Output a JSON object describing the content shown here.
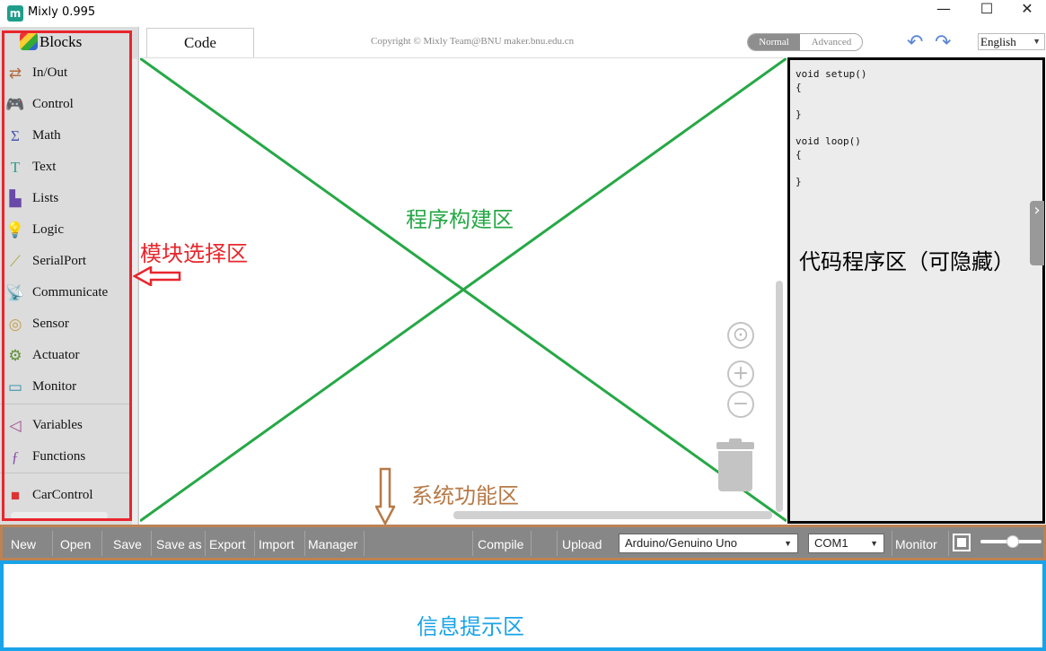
{
  "app": {
    "logo_text": "m",
    "title": "Mixly 0.995"
  },
  "window": {
    "minimize": "—",
    "maximize": "☐",
    "close": "✕"
  },
  "toolbox": {
    "header": "Blocks",
    "categories": [
      {
        "label": "In/Out",
        "icon": "in-out-icon",
        "glyph": "⇄",
        "color": "#b46a3c"
      },
      {
        "label": "Control",
        "icon": "gamepad-icon",
        "glyph": "🎮",
        "color": "#3d8a3d"
      },
      {
        "label": "Math",
        "icon": "math-icon",
        "glyph": "Σ",
        "color": "#4a55b0"
      },
      {
        "label": "Text",
        "icon": "text-icon",
        "glyph": "T",
        "color": "#2c9b8a"
      },
      {
        "label": "Lists",
        "icon": "lists-icon",
        "glyph": "▙",
        "color": "#6a4aa8"
      },
      {
        "label": "Logic",
        "icon": "lightbulb-icon",
        "glyph": "💡",
        "color": "#4479b8"
      },
      {
        "label": "SerialPort",
        "icon": "serial-port-icon",
        "glyph": "⟋",
        "color": "#a4a83a"
      },
      {
        "label": "Communicate",
        "icon": "satellite-icon",
        "glyph": "📡",
        "color": "#6b8f3b"
      },
      {
        "label": "Sensor",
        "icon": "sensor-icon",
        "glyph": "◎",
        "color": "#c4a04a"
      },
      {
        "label": "Actuator",
        "icon": "actuator-icon",
        "glyph": "⚙",
        "color": "#5f8f34"
      },
      {
        "label": "Monitor",
        "icon": "monitor-icon",
        "glyph": "▭",
        "color": "#2f8fa8"
      },
      {
        "label": "Variables",
        "icon": "variables-icon",
        "glyph": "◁",
        "color": "#a04a8a"
      },
      {
        "label": "Functions",
        "icon": "functions-icon",
        "glyph": "ƒ",
        "color": "#8a4aa8"
      },
      {
        "label": "CarControl",
        "icon": "cube-icon",
        "glyph": "■",
        "color": "#d33"
      }
    ]
  },
  "tabs": {
    "code": "Code"
  },
  "copyright": "Copyright © Mixly Team@BNU maker.bnu.edu.cn",
  "mode": {
    "normal": "Normal",
    "advanced": "Advanced"
  },
  "history": {
    "undo": "↶",
    "redo": "↷"
  },
  "language": {
    "selected": "English"
  },
  "code": "void setup()\n{\n\n}\n\nvoid loop()\n{\n\n}",
  "workspace": {
    "recenter": "⊙",
    "zoom_in": "+",
    "zoom_out": "−"
  },
  "annotations": {
    "build_area": "程序构建区",
    "blocks_area": "模块选择区",
    "code_area": "代码程序区（可隐藏）",
    "system_area": "系统功能区",
    "message_area": "信息提示区"
  },
  "annotation_colors": {
    "build": "#26a846",
    "blocks": "#e8262c",
    "code": "#000000",
    "system": "#b77946",
    "message": "#1aa3e8"
  },
  "toolbar": {
    "new": "New",
    "open": "Open",
    "save": "Save",
    "save_as": "Save as",
    "export": "Export",
    "import": "Import",
    "manager": "Manager",
    "compile": "Compile",
    "upload": "Upload",
    "board": "Arduino/Genuino Uno",
    "port": "COM1",
    "monitor": "Monitor"
  },
  "panel_toggle": "›"
}
